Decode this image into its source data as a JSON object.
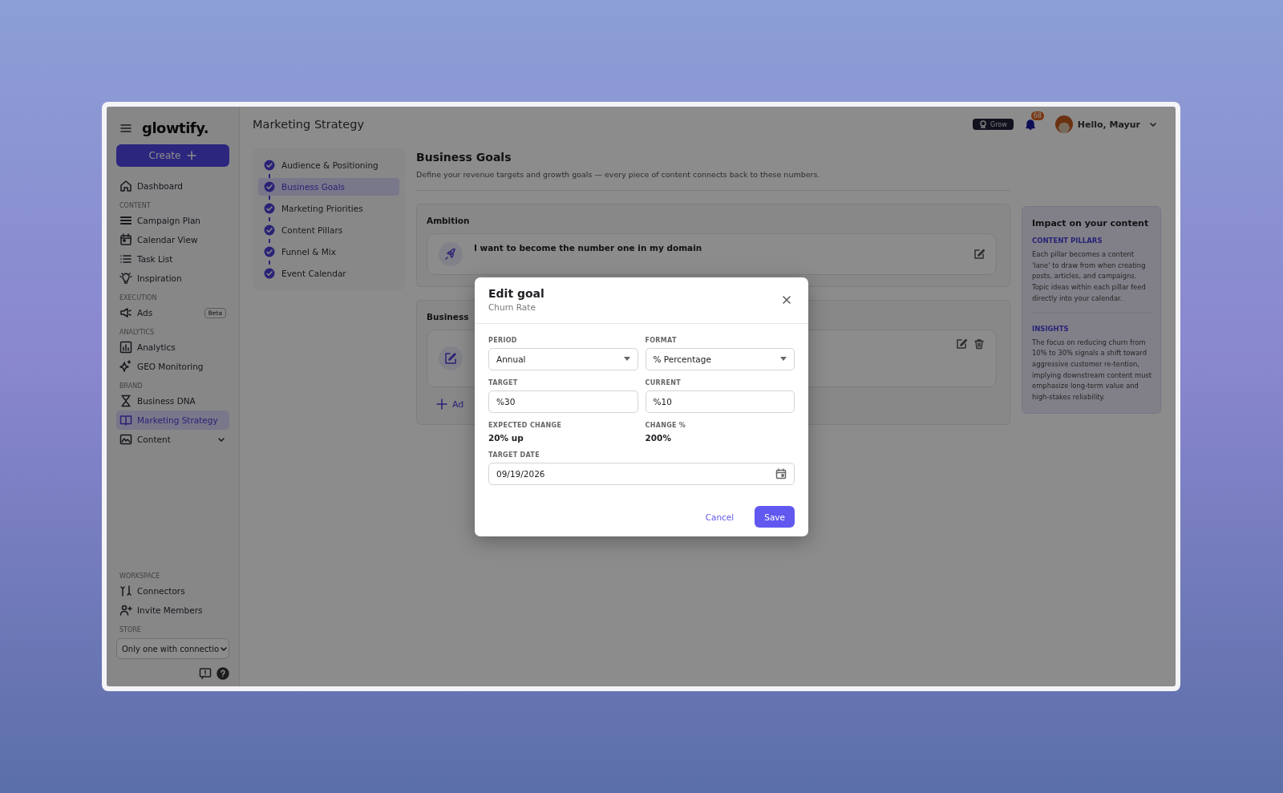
{
  "sidebar": {
    "logo": "glowtify.",
    "create_button": "Create",
    "sections": [
      {
        "items": [
          {
            "label": "Dashboard",
            "selected": false
          }
        ]
      },
      {
        "heading": "CONTENT",
        "items": [
          {
            "label": "Campaign Plan",
            "selected": false
          },
          {
            "label": "Calendar View",
            "selected": false
          },
          {
            "label": "Task List",
            "selected": false
          },
          {
            "label": "Inspiration",
            "selected": false
          }
        ]
      },
      {
        "heading": "EXECUTION",
        "items": [
          {
            "label": "Ads",
            "selected": false,
            "badge": "Beta"
          }
        ]
      },
      {
        "heading": "ANALYTICS",
        "items": [
          {
            "label": "Analytics",
            "selected": false
          },
          {
            "label": "GEO Monitoring",
            "selected": false
          }
        ]
      },
      {
        "heading": "BRAND",
        "items": [
          {
            "label": "Business DNA",
            "selected": false
          },
          {
            "label": "Marketing Strategy",
            "selected": true
          },
          {
            "label": "Content",
            "selected": false,
            "expanded": false
          }
        ]
      }
    ],
    "bottom_sections": [
      {
        "heading": "WORKSPACE",
        "items": [
          {
            "label": "Connectors",
            "selected": false
          },
          {
            "label": "Invite Members",
            "selected": false
          }
        ]
      },
      {
        "heading": "STORE"
      }
    ],
    "store_select": "Only one with connectio"
  },
  "header": {
    "title": "Marketing Strategy",
    "plan_badge": "Grow",
    "notifications": "68",
    "greeting": "Hello, Mayur"
  },
  "steps": [
    {
      "label": "Audience & Positioning",
      "selected": false,
      "done": true
    },
    {
      "label": "Business Goals",
      "selected": true,
      "done": true
    },
    {
      "label": "Marketing Priorities",
      "selected": false,
      "done": true
    },
    {
      "label": "Content Pillars",
      "selected": false,
      "done": true
    },
    {
      "label": "Funnel & Mix",
      "selected": false,
      "done": true
    },
    {
      "label": "Event Calendar",
      "selected": false,
      "done": true
    }
  ],
  "page": {
    "title": "Business Goals",
    "subtitle": "Define your revenue targets and growth goals — every piece of content connects back to these numbers.",
    "ambition": {
      "title": "Ambition",
      "text": "I want to become the number one in my domain"
    },
    "business": {
      "title": "Business",
      "add_link": "Ad"
    }
  },
  "impact": {
    "title": "Impact on your content",
    "sections": [
      {
        "heading": "CONTENT PILLARS",
        "text": "Each pillar becomes a content 'lane' to draw from when creating posts, articles, and campaigns. Topic ideas within each pillar feed directly into your calendar."
      },
      {
        "heading": "INSIGHTS",
        "text": "The focus on reducing churn from 10% to 30% signals a shift toward aggressive customer re-tention, implying downstream content must emphasize long-term value and high-stakes reliability."
      }
    ]
  },
  "modal": {
    "title": "Edit goal",
    "subtitle": "Churn Rate",
    "fields": [
      {
        "kind": "select",
        "label": "PERIOD",
        "value": "Annual"
      },
      {
        "kind": "select",
        "label": "FORMAT",
        "value": "% Percentage"
      },
      {
        "kind": "input",
        "label": "TARGET",
        "value": "%30"
      },
      {
        "kind": "input",
        "label": "CURRENT",
        "value": "%10"
      },
      {
        "kind": "readout",
        "label": "EXPECTED CHANGE",
        "value": "20% up"
      },
      {
        "kind": "readout",
        "label": "CHANGE %",
        "value": "200%"
      },
      {
        "kind": "date",
        "label": "TARGET DATE",
        "value": "09/19/2026"
      }
    ],
    "buttons": [
      {
        "label": "Cancel",
        "kind": "secondary"
      },
      {
        "label": "Save",
        "kind": "primary"
      }
    ]
  }
}
